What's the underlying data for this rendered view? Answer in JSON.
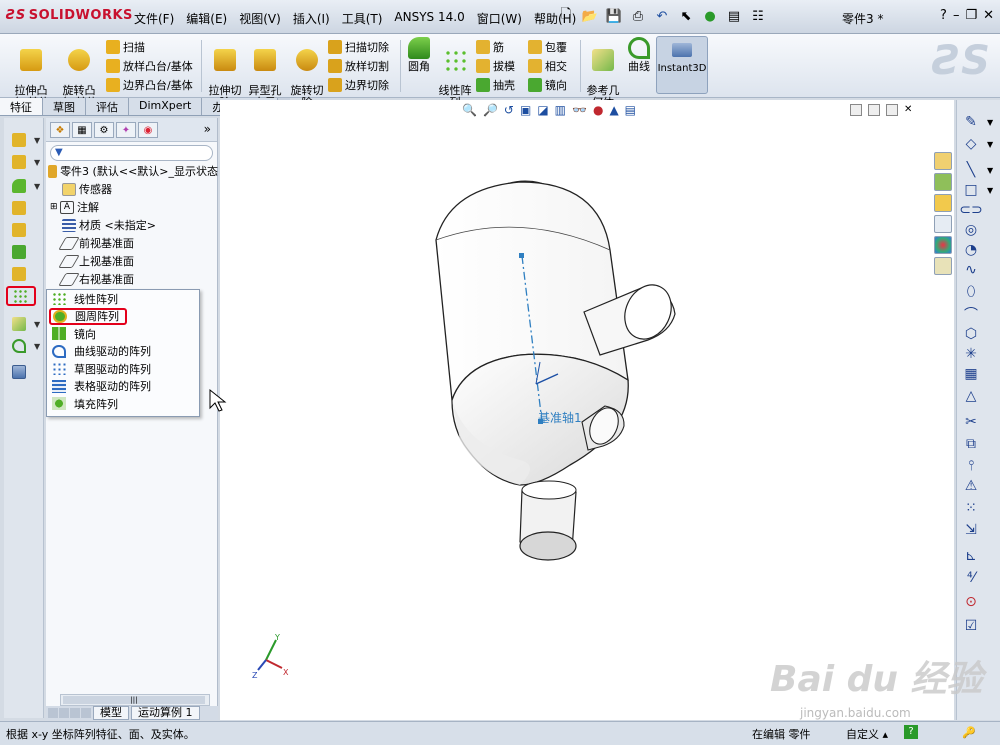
{
  "app": {
    "brand": "SOLIDWORKS",
    "document_title": "零件3 *",
    "menu": [
      "文件(F)",
      "编辑(E)",
      "视图(V)",
      "插入(I)",
      "工具(T)",
      "ANSYS 14.0",
      "窗口(W)",
      "帮助(H)"
    ],
    "help_icon": "?"
  },
  "command_manager": {
    "extrude_boss": "拉伸凸\n台/基体",
    "revolve_boss": "旋转凸\n台/基体",
    "sweep": "扫描",
    "loft_boss": "放样凸台/基体",
    "boundary_boss": "边界凸台/基体",
    "extrude_cut": "拉伸切\n除",
    "hole_wizard": "异型孔\n向导",
    "revolve_cut": "旋转切\n除",
    "sweep_cut": "扫描切除",
    "loft_cut": "放样切割",
    "boundary_cut": "边界切除",
    "fillet": "圆角",
    "linear_pattern": "线性阵\n列",
    "rib": "筋",
    "draft": "拔模",
    "shell": "抽壳",
    "wrap": "包覆",
    "intersect": "相交",
    "mirror": "镜向",
    "ref_geometry": "参考几\n何体",
    "curves": "曲线",
    "instant3d": "Instant3D"
  },
  "tabs": [
    "特征",
    "草图",
    "评估",
    "DimXpert",
    "办公室产品"
  ],
  "feature_tree": {
    "part": "零件3  (默认<<默认>_显示状态",
    "items": [
      "传感器",
      "注解",
      "材质 <未指定>",
      "前视基准面",
      "上视基准面",
      "右视基准面"
    ]
  },
  "pattern_menu": {
    "items": [
      "线性阵列",
      "圆周阵列",
      "镜向",
      "曲线驱动的阵列",
      "草图驱动的阵列",
      "表格驱动的阵列",
      "填充阵列"
    ]
  },
  "viewport": {
    "axis_label": "基准轴1",
    "triad": {
      "x": "X",
      "y": "Y",
      "z": "Z"
    }
  },
  "bottom_tabs": [
    "模型",
    "运动算例 1"
  ],
  "status": {
    "message": "根据 x-y 坐标阵列特征、面、及实体。",
    "editing": "在编辑 零件",
    "custom": "自定义"
  },
  "watermark": {
    "text": "Bai du 经验",
    "url": "jingyan.baidu.com"
  },
  "colors": {
    "accent_red": "#e3001b",
    "brand_red": "#c8102e",
    "axis_blue": "#2f7fc1"
  }
}
